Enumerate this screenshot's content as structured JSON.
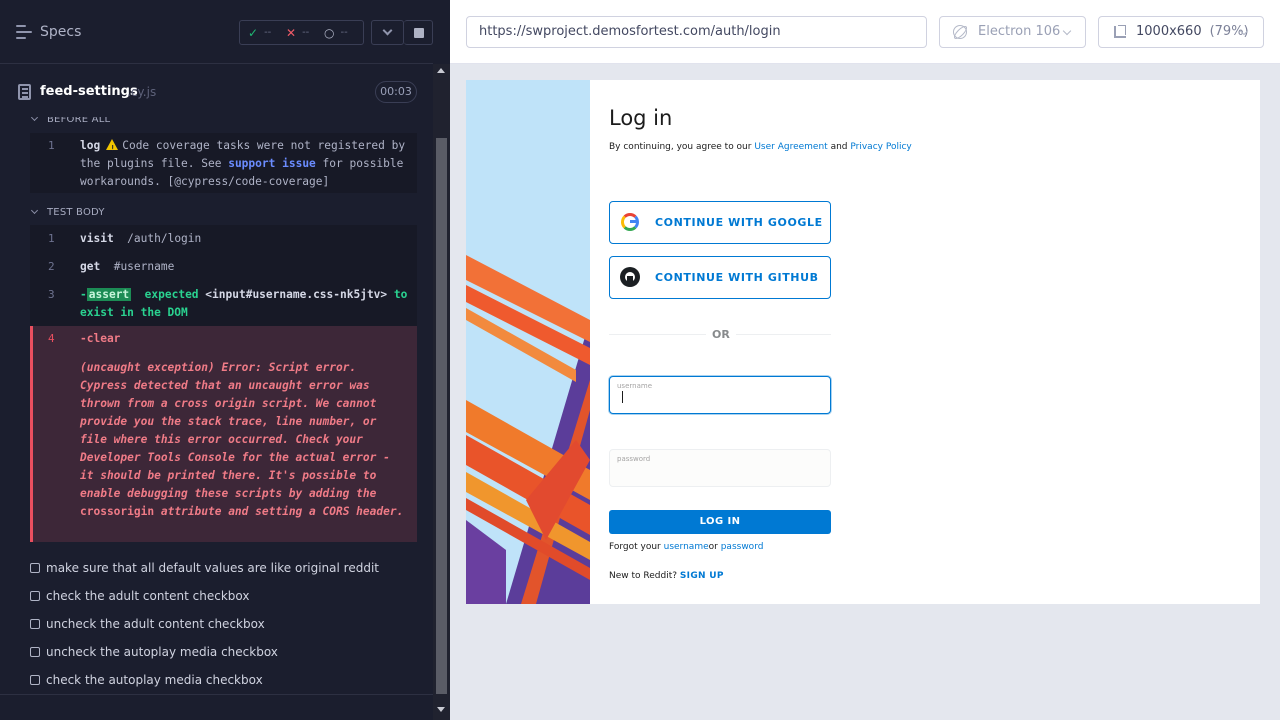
{
  "runner": {
    "header": {
      "title": "Specs",
      "passed": "--",
      "failed": "--",
      "pending": "--"
    },
    "spec": {
      "name": "feed-settings",
      "ext": ".cy.js",
      "duration": "00:03"
    },
    "before_all": {
      "label": "BEFORE ALL",
      "command": {
        "num": "1",
        "name": "log",
        "msg_pre": "Code coverage tasks were not registered by the plugins file. See",
        "link1": "support",
        "link2": "issue",
        "msg_post": "for possible workarounds. [@cypress/code-coverage]"
      }
    },
    "test_body": {
      "label": "TEST BODY",
      "commands": [
        {
          "num": "1",
          "name": "visit",
          "arg": "/auth/login"
        },
        {
          "num": "2",
          "name": "get",
          "arg": "#username"
        },
        {
          "num": "3",
          "badge": "assert",
          "msg_a": "expected",
          "msg_b": "<input#username.css-nk5jtv>",
          "msg_c": "to exist in the DOM"
        }
      ],
      "error": {
        "num": "4",
        "name": "-clear",
        "msg_pre": "(uncaught exception)  Error: Script error. Cypress detected that an uncaught error was thrown from a cross origin script. We cannot provide you the stack trace, line number, or file where this error occurred. Check your Developer Tools Console for the actual error - it should be printed there. It's possible to enable debugging these scripts by adding the",
        "code": "crossorigin",
        "msg_post": "attribute and setting a CORS header."
      }
    },
    "tests": [
      "make sure that all default values are like original reddit",
      "check the adult content checkbox",
      "uncheck the adult content checkbox",
      "uncheck the autoplay media checkbox",
      "check the autoplay media checkbox"
    ]
  },
  "browser_bar": {
    "url": "https://swproject.demosfortest.com/auth/login",
    "browser": "Electron 106",
    "viewport": "1000x660",
    "zoom": "(79%)"
  },
  "login_page": {
    "title": "Log in",
    "agree_pre": "By continuing, you agree to our",
    "user_agreement": "User Agreement",
    "and": "and",
    "privacy_policy": "Privacy Policy",
    "google_btn": "CONTINUE WITH GOOGLE",
    "github_btn": "CONTINUE WITH GITHUB",
    "or": "OR",
    "username_label": "username",
    "password_label": "password",
    "login_btn": "LOG IN",
    "forgot_pre": "Forgot your",
    "forgot_username": "username",
    "forgot_or": "or",
    "forgot_password": "password",
    "new_pre": "New to Reddit?",
    "signup": "SIGN UP"
  },
  "colors": {
    "runner_bg": "#1b1e2e",
    "pass": "#20b873",
    "fail": "#ef5a67",
    "link": "#0079d3"
  }
}
